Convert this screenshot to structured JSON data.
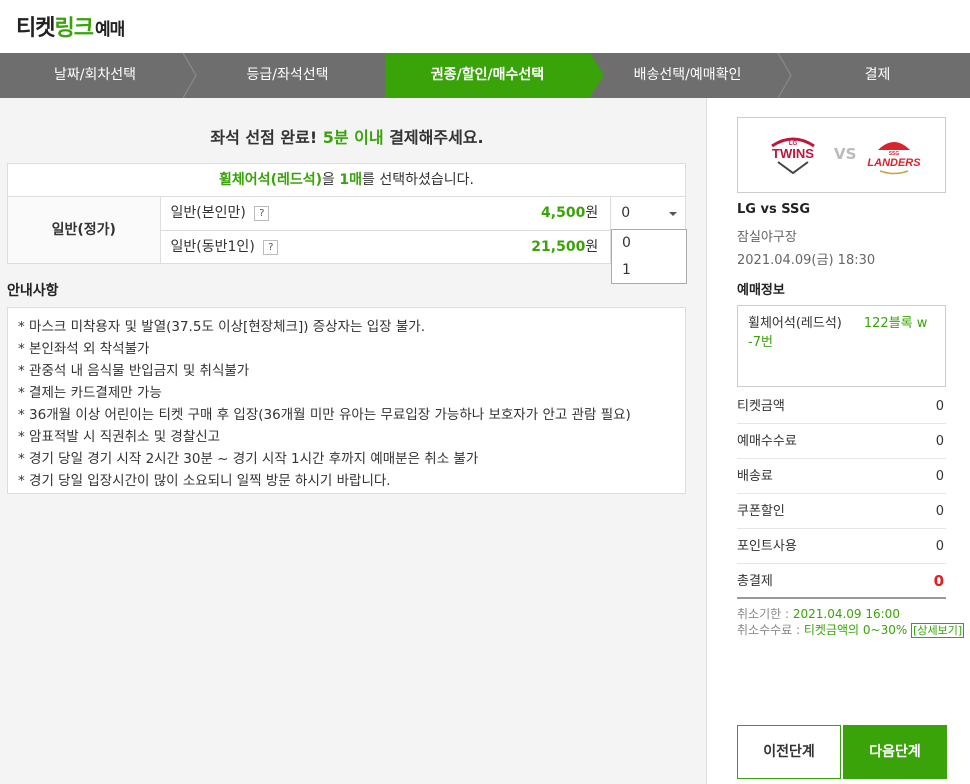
{
  "header": {
    "logo_part1": "티켓",
    "logo_part2": "링크",
    "logo_part3": "예매"
  },
  "steps": [
    {
      "label": "날짜/회차선택",
      "active": false
    },
    {
      "label": "등급/좌석선택",
      "active": false
    },
    {
      "label": "권종/할인/매수선택",
      "active": true
    },
    {
      "label": "배송선택/예매확인",
      "active": false
    },
    {
      "label": "결제",
      "active": false
    }
  ],
  "notice": {
    "prefix": "좌석 선점 완료!",
    "highlight": "5분 이내",
    "suffix": "결제해주세요."
  },
  "seat_selection": {
    "grade": "휠체어석(레드석)",
    "mid": "을",
    "count": "1매",
    "suffix": "를 선택하셨습니다."
  },
  "price_table": {
    "type_label": "일반(정가)",
    "rows": [
      {
        "name": "일반(본인만)",
        "help": "?",
        "price": "4,500",
        "unit": "원",
        "qty": "0"
      },
      {
        "name": "일반(동반1인)",
        "help": "?",
        "price": "21,500",
        "unit": "원"
      }
    ]
  },
  "qty_dropdown": {
    "options": [
      "0",
      "1"
    ]
  },
  "guide": {
    "title": "안내사항",
    "items": [
      "* 마스크 미착용자 및 발열(37.5도 이상[현장체크]) 증상자는 입장 불가.",
      "* 본인좌석 외 착석불가",
      "* 관중석 내 음식물 반입금지 및 취식불가",
      "* 결제는 카드결제만 가능",
      "* 36개월 이상 어린이는 티켓 구매 후 입장(36개월 미만 유아는 무료입장 가능하나 보호자가 안고 관람 필요)",
      "* 암표적발 시 직권취소 및 경찰신고",
      "* 경기 당일 경기 시작 2시간 30분 ~ 경기 시작 1시간 후까지 예매분은 취소 불가",
      "* 경기 당일 입장시간이 많이 소요되니 일찍 방문 하시기 바랍니다."
    ]
  },
  "sidebar": {
    "team_home": "TWINS",
    "team_home_small": "LG",
    "vs": "VS",
    "team_away": "LANDERS",
    "team_away_small": "SSG",
    "match_title": "LG vs SSG",
    "venue": "잠실야구장",
    "date": "2021.04.09(금) 18:30",
    "info_title": "예매정보",
    "seat_name": "휠체어석(레드석)",
    "seat_no": "122블록 w -7번",
    "costs": [
      {
        "label": "티켓금액",
        "value": "0"
      },
      {
        "label": "예매수수료",
        "value": "0"
      },
      {
        "label": "배송료",
        "value": "0"
      },
      {
        "label": "쿠폰할인",
        "value": "0"
      },
      {
        "label": "포인트사용",
        "value": "0"
      },
      {
        "label": "총결제",
        "value": "0"
      }
    ],
    "cancel_deadline_label": "취소기한 : ",
    "cancel_deadline": "2021.04.09 16:00",
    "cancel_fee_label": "취소수수료 : ",
    "cancel_fee": "티켓금액의 0~30%",
    "cancel_fee_link": "[상세보기]",
    "prev_button": "이전단계",
    "next_button": "다음단계"
  },
  "colors": {
    "accent": "#3aa30a",
    "step_bar": "#6e6e6e",
    "total_red": "#e02020"
  }
}
